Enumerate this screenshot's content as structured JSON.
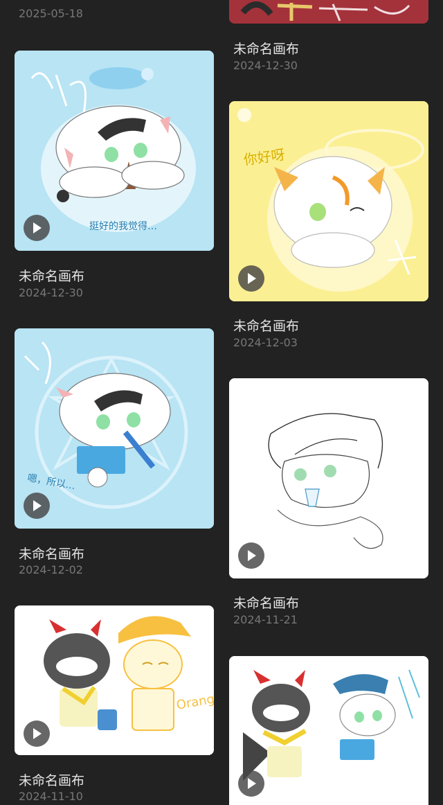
{
  "gallery": {
    "items": [
      {
        "title": "",
        "date": "2025-05-18"
      },
      {
        "title": "未命名画布",
        "date": "2024-12-30"
      },
      {
        "title": "未命名画布",
        "date": "2024-12-30"
      },
      {
        "title": "未命名画布",
        "date": "2024-12-03"
      },
      {
        "title": "未命名画布",
        "date": "2024-12-02"
      },
      {
        "title": "未命名画布",
        "date": "2024-11-21"
      },
      {
        "title": "未命名画布",
        "date": "2024-11-10"
      },
      {
        "title": "",
        "date": ""
      }
    ],
    "artwork_text": {
      "a1": "挺好的我觉得…",
      "a3": "你好呀",
      "a4": "嗯，所以…",
      "a6": "Orange Juice"
    }
  },
  "colors": {
    "background": "#222222",
    "title": "#e4e4e4",
    "date": "#777777",
    "light_blue": "#b8e4f4",
    "yellow": "#fbef93"
  }
}
